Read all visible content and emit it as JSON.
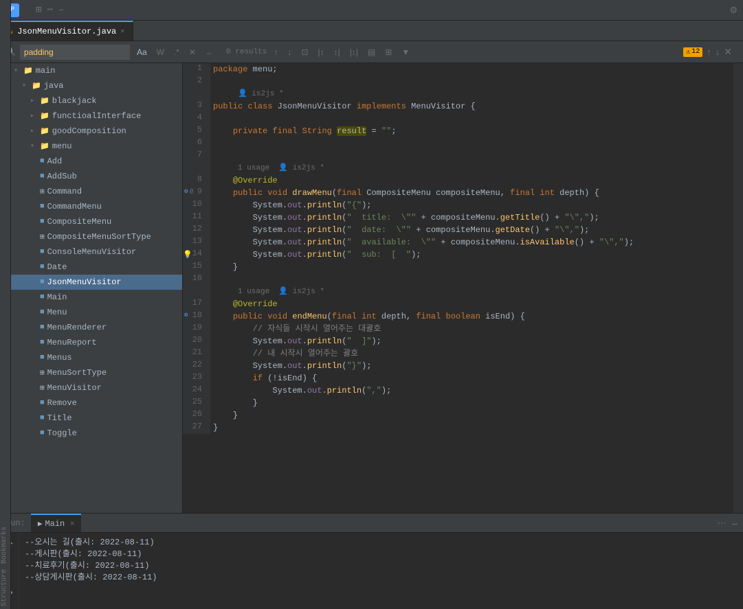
{
  "titleBar": {
    "icons": [
      "⊞",
      "⋯",
      "–"
    ]
  },
  "tabs": [
    {
      "label": "JsonMenuVisitor.java",
      "icon": "☕",
      "active": true,
      "closable": true
    }
  ],
  "searchBar": {
    "query": "padding",
    "buttons": [
      "Aa",
      "W",
      ".*"
    ],
    "results": "0 results",
    "navBtns": [
      "↑",
      "↓",
      "⊡",
      "⊞",
      "⊟",
      "⊠",
      "▤",
      "⊞",
      "▼"
    ]
  },
  "sidebar": {
    "items": [
      {
        "label": "main",
        "indent": 0,
        "icon": "▸",
        "type": "folder",
        "expanded": true
      },
      {
        "label": "java",
        "indent": 1,
        "icon": "▸",
        "type": "folder",
        "expanded": true
      },
      {
        "label": "blackjack",
        "indent": 2,
        "icon": "▸",
        "type": "folder"
      },
      {
        "label": "functioalInterface",
        "indent": 2,
        "icon": "▸",
        "type": "folder"
      },
      {
        "label": "goodComposition",
        "indent": 2,
        "icon": "▸",
        "type": "folder"
      },
      {
        "label": "menu",
        "indent": 2,
        "icon": "▾",
        "type": "folder",
        "expanded": true
      },
      {
        "label": "Add",
        "indent": 3,
        "icon": "■",
        "type": "class"
      },
      {
        "label": "AddSub",
        "indent": 3,
        "icon": "■",
        "type": "class"
      },
      {
        "label": "Command",
        "indent": 3,
        "icon": "⊞",
        "type": "interface",
        "selected": false
      },
      {
        "label": "CommandMenu",
        "indent": 3,
        "icon": "■",
        "type": "class"
      },
      {
        "label": "CompositeMenu",
        "indent": 3,
        "icon": "■",
        "type": "class"
      },
      {
        "label": "CompositeMenuSortType",
        "indent": 3,
        "icon": "⊞",
        "type": "interface"
      },
      {
        "label": "ConsoleMenuVisitor",
        "indent": 3,
        "icon": "■",
        "type": "class"
      },
      {
        "label": "Date",
        "indent": 3,
        "icon": "■",
        "type": "class"
      },
      {
        "label": "JsonMenuVisitor",
        "indent": 3,
        "icon": "■",
        "type": "class",
        "selected": true
      },
      {
        "label": "Main",
        "indent": 3,
        "icon": "■",
        "type": "class"
      },
      {
        "label": "Menu",
        "indent": 3,
        "icon": "■",
        "type": "class"
      },
      {
        "label": "MenuRenderer",
        "indent": 3,
        "icon": "■",
        "type": "class"
      },
      {
        "label": "MenuReport",
        "indent": 3,
        "icon": "■",
        "type": "class"
      },
      {
        "label": "Menus",
        "indent": 3,
        "icon": "■",
        "type": "class"
      },
      {
        "label": "MenuSortType",
        "indent": 3,
        "icon": "⊞",
        "type": "interface"
      },
      {
        "label": "MenuVisitor",
        "indent": 3,
        "icon": "⊞",
        "type": "interface"
      },
      {
        "label": "Remove",
        "indent": 3,
        "icon": "■",
        "type": "class"
      },
      {
        "label": "Title",
        "indent": 3,
        "icon": "■",
        "type": "class"
      },
      {
        "label": "Toggle",
        "indent": 3,
        "icon": "■",
        "type": "class"
      }
    ]
  },
  "editor": {
    "filename": "JsonMenuVisitor.java",
    "warningCount": "12",
    "lines": [
      {
        "num": 1,
        "content": "package menu;"
      },
      {
        "num": 2,
        "content": ""
      },
      {
        "num": 3,
        "content": "",
        "meta": "is2js_meta",
        "metaContent": "👤 is2js *"
      },
      {
        "num": 3,
        "code": "public class JsonMenuVisitor implements MenuVisitor {"
      },
      {
        "num": 4,
        "content": ""
      },
      {
        "num": 5,
        "content": "    private final String result = \"\";"
      },
      {
        "num": 6,
        "content": ""
      },
      {
        "num": 7,
        "content": ""
      },
      {
        "num": 8,
        "metaContent": "1 usage  👤 is2js *"
      },
      {
        "num": 8,
        "code": "    @Override"
      },
      {
        "num": 9,
        "code": "    public void drawMenu(final CompositeMenu compositeMenu, final int depth) {",
        "hasGutter": true
      },
      {
        "num": 10,
        "code": "        System.out.println(\"{\");"
      },
      {
        "num": 11,
        "code": "        System.out.println(\"  title:  \\\"\" + compositeMenu.getTitle() + \"\\\",\");"
      },
      {
        "num": 12,
        "code": "        System.out.println(\"  date:  \\\"\" + compositeMenu.getDate() + \"\\\",\");"
      },
      {
        "num": 13,
        "code": "        System.out.println(\"  available:  \\\"\" + compositeMenu.isAvailable() + \"\\\",\");"
      },
      {
        "num": 14,
        "code": "        System.out.println(\"  sub:  [  \");",
        "hasGutter": true,
        "gutterIcon": "💡"
      },
      {
        "num": 15,
        "code": "    }"
      },
      {
        "num": 16,
        "code": ""
      },
      {
        "num": 17,
        "metaContent": "1 usage  👤 is2js *"
      },
      {
        "num": 17,
        "code": "    @Override"
      },
      {
        "num": 18,
        "code": "    public void endMenu(final int depth, final boolean isEnd) {",
        "hasGutter2": true
      },
      {
        "num": 19,
        "code": "        // 자식들 시작시 열어주는 대괄호"
      },
      {
        "num": 20,
        "code": "        System.out.println(\"  ]\");"
      },
      {
        "num": 21,
        "code": "        // 내 시작시 열어주는 괄호"
      },
      {
        "num": 22,
        "code": "        System.out.println(\"}\");"
      },
      {
        "num": 23,
        "code": "        if (!isEnd) {"
      },
      {
        "num": 24,
        "code": "            System.out.println(\",\");"
      },
      {
        "num": 25,
        "code": "        }"
      },
      {
        "num": 26,
        "code": "    }"
      },
      {
        "num": 27,
        "code": "}"
      }
    ]
  },
  "bottomPanel": {
    "tabLabel": "Main",
    "runOutput": [
      "--오시는 길(출시: 2022-08-11)",
      "--게시판(출시: 2022-08-11)",
      "--치료후기(출시: 2022-08-11)",
      "--상담게시판(출시: 2022-08-11)"
    ]
  }
}
